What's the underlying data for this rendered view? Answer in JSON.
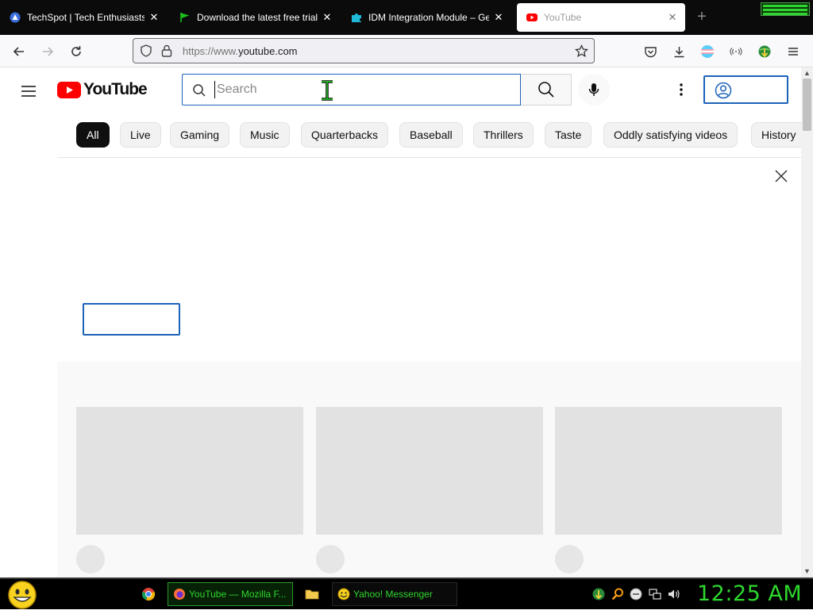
{
  "browser": {
    "tabs": [
      {
        "title": "TechSpot | Tech Enthusiasts, P",
        "icon": "techspot-icon",
        "active": false
      },
      {
        "title": "Download the latest free trial v",
        "icon": "green-flag-icon",
        "active": false
      },
      {
        "title": "IDM Integration Module – Get",
        "icon": "puzzle-piece-icon",
        "active": false
      },
      {
        "title": "YouTube",
        "icon": "youtube-icon",
        "active": true
      }
    ],
    "close_glyph": "✕",
    "newtab_glyph": "+",
    "url_scheme": "https://www.",
    "url_host": "youtube.com"
  },
  "youtube": {
    "logo_text": "YouTube",
    "search_placeholder": "Search",
    "chips": [
      "All",
      "Live",
      "Gaming",
      "Music",
      "Quarterbacks",
      "Baseball",
      "Thrillers",
      "Taste",
      "Oddly satisfying videos",
      "History"
    ],
    "active_chip": "All"
  },
  "taskbar": {
    "items": [
      {
        "label": "YouTube — Mozilla F...",
        "icon": "firefox-icon",
        "active": true
      },
      {
        "label": "Yahoo! Messenger",
        "icon": "yahoo-messenger-icon",
        "active": false
      }
    ],
    "clock": "12:25 AM"
  },
  "colors": {
    "youtube_red": "#ff0000",
    "focus_blue": "#1c62b9",
    "taskbar_green": "#2ed62e"
  }
}
